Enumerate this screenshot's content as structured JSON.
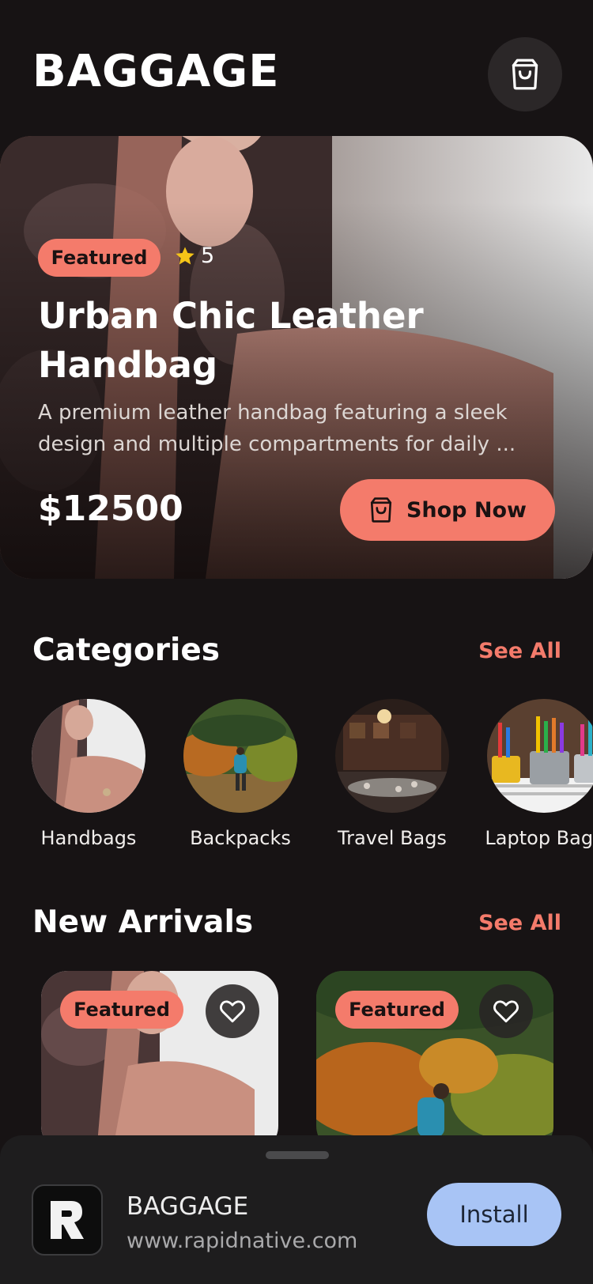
{
  "header": {
    "title": "BAGGAGE",
    "cart_icon": "shopping-bag-icon"
  },
  "hero": {
    "badge": "Featured",
    "rating": "5",
    "rating_icon": "star-icon",
    "title": "Urban Chic Leather Handbag",
    "description": "A premium leather handbag featuring a sleek design and multiple compartments for daily ...",
    "price": "$12500",
    "cta_label": "Shop Now",
    "cta_icon": "shopping-bag-icon"
  },
  "categories": {
    "title": "Categories",
    "see_all": "See All",
    "items": [
      {
        "label": "Handbags"
      },
      {
        "label": "Backpacks"
      },
      {
        "label": "Travel Bags"
      },
      {
        "label": "Laptop Bags"
      }
    ]
  },
  "new_arrivals": {
    "title": "New Arrivals",
    "see_all": "See All",
    "items": [
      {
        "badge": "Featured",
        "favorite_icon": "heart-icon"
      },
      {
        "badge": "Featured",
        "favorite_icon": "heart-icon"
      }
    ]
  },
  "install_banner": {
    "app_name": "BAGGAGE",
    "url": "www.rapidnative.com",
    "install_label": "Install"
  },
  "colors": {
    "background": "#171314",
    "accent": "#f47b6b",
    "install_button": "#a8c4f5"
  }
}
